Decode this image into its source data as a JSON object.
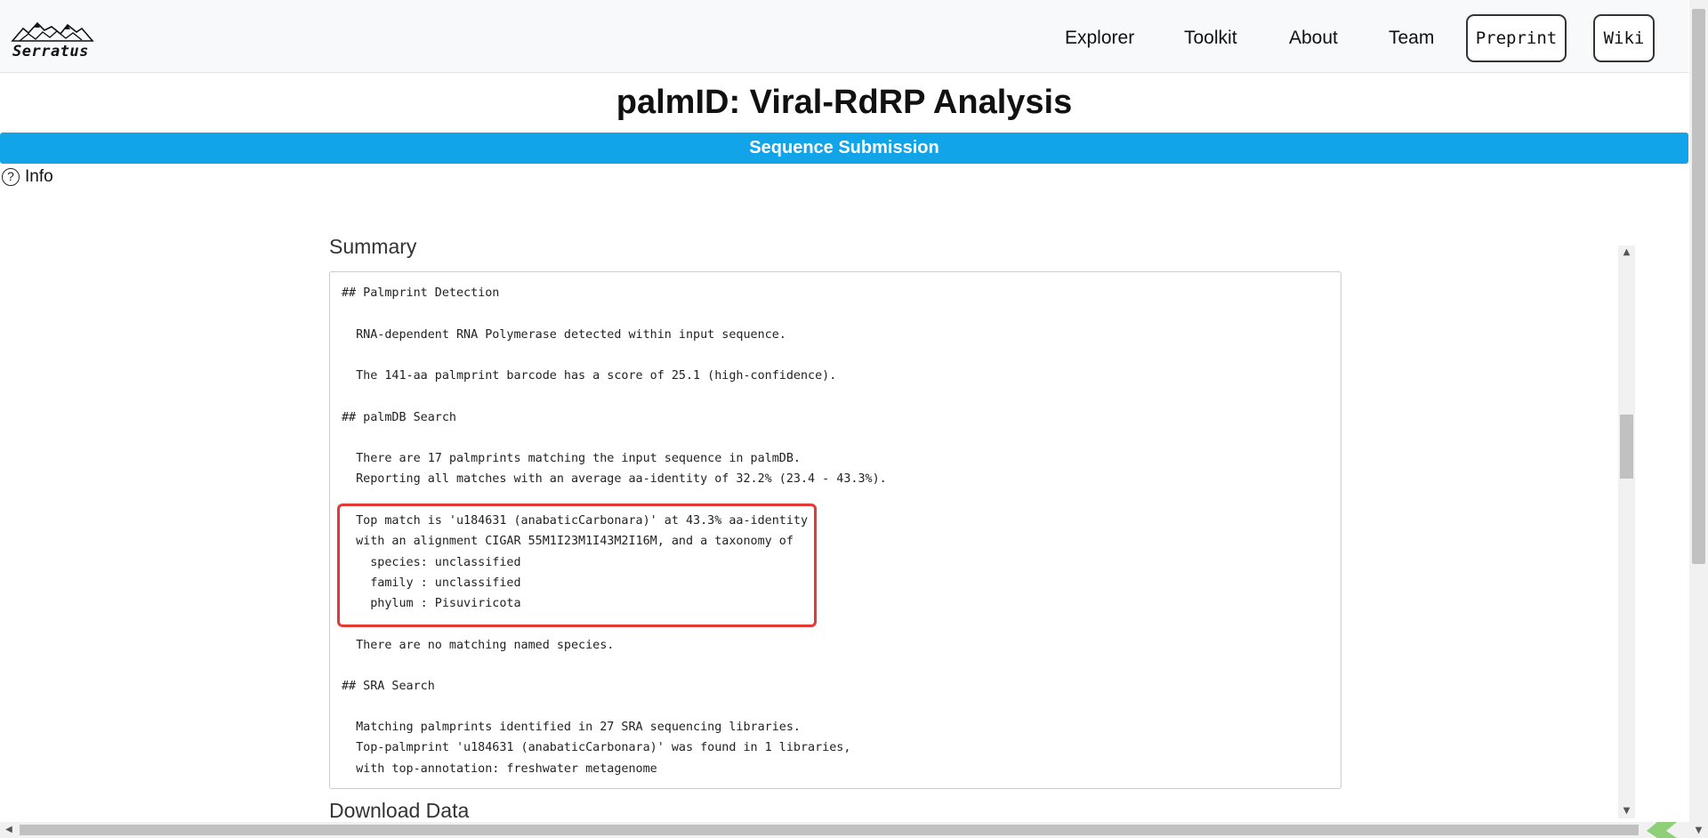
{
  "nav": {
    "logo_text": "Serratus",
    "links": [
      "Explorer",
      "Toolkit",
      "About",
      "Team"
    ],
    "buttons": [
      "Preprint",
      "Wiki"
    ]
  },
  "header": {
    "title": "palmID: Viral-RdRP Analysis",
    "section_bar": "Sequence Submission",
    "info_label": "Info"
  },
  "summary": {
    "heading": "Summary",
    "lines": [
      "## Palmprint Detection",
      "  RNA-dependent RNA Polymerase detected within input sequence.",
      "  The 141-aa palmprint barcode has a score of 25.1 (high-confidence).",
      "## palmDB Search",
      "  There are 17 palmprints matching the input sequence in palmDB.",
      "  Reporting all matches with an average aa-identity of 32.2% (23.4 - 43.3%).",
      "  Top match is 'u184631 (anabaticCarbonara)' at 43.3% aa-identity",
      "  with an alignment CIGAR 55M1I23M1I43M2I16M, and a taxonomy of",
      "    species: unclassified",
      "    family : unclassified",
      "    phylum : Pisuviricota",
      "  There are no matching named species.",
      "## SRA Search",
      "  Matching palmprints identified in 27 SRA sequencing libraries.",
      "  Top-palmprint 'u184631 (anabaticCarbonara)' was found in 1 libraries,",
      "  with top-annotation: freshwater metagenome"
    ]
  },
  "download": {
    "heading": "Download Data"
  }
}
